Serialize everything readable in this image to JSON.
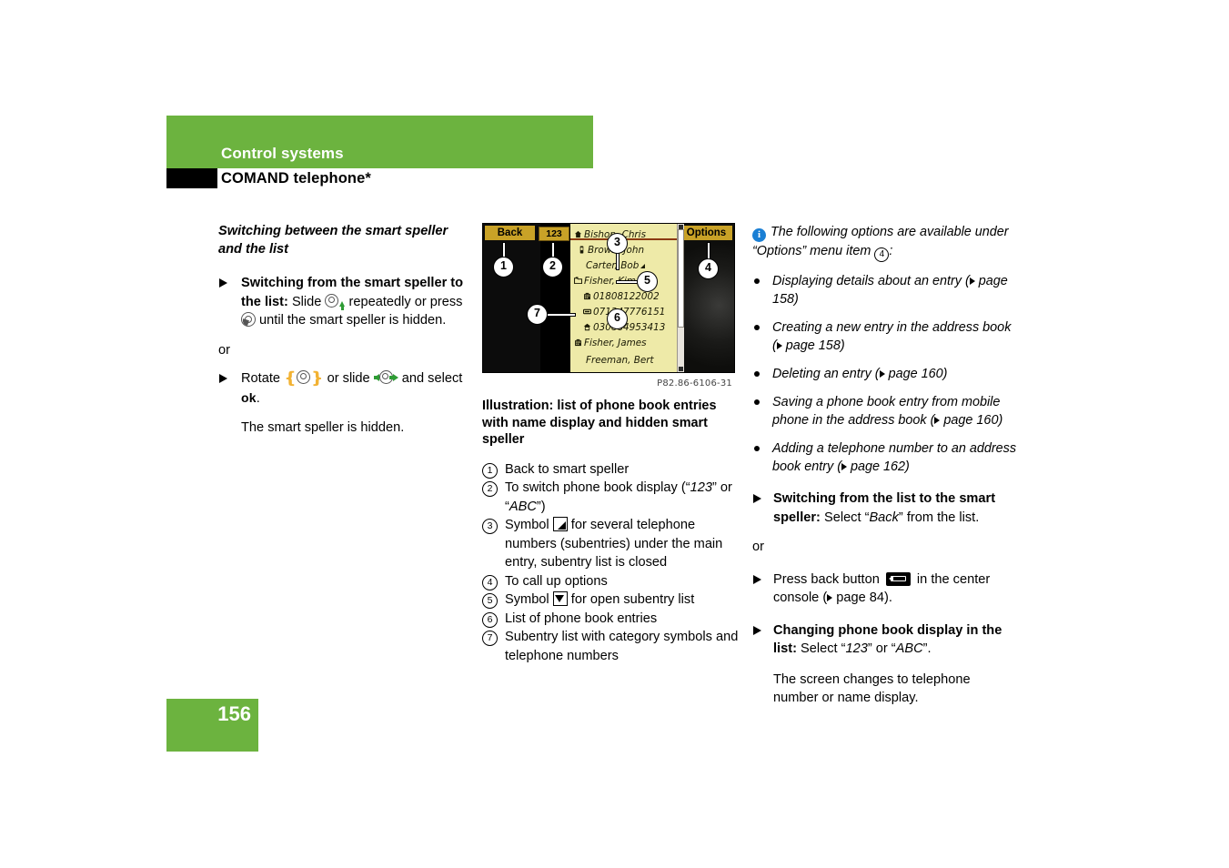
{
  "header": {
    "section": "Control systems",
    "subsection": "COMAND telephone*"
  },
  "footer": {
    "page_number": "156"
  },
  "left_column": {
    "subhead": "Switching between the smart speller and the list",
    "item1": {
      "bold_lead": "Switching from the smart speller to the list:",
      "text_a": " Slide ",
      "text_b": " repeatedly or press ",
      "text_c": " until the smart speller is hidden."
    },
    "or_label": "or",
    "item2": {
      "text_a": "Rotate ",
      "text_b": " or slide ",
      "text_c": " and select ",
      "ok_label": "ok",
      "text_d": "."
    },
    "result": "The smart speller is hidden."
  },
  "illustration": {
    "code": "P82.86-6106-31",
    "screen": {
      "back_button": "Back",
      "num_button": "123",
      "options_button": "Options",
      "entries": [
        {
          "icon": "home-icon",
          "text": "Bishop, Chris",
          "caret": false
        },
        {
          "icon": "mobile-icon",
          "text": "Brown, John",
          "caret": false
        },
        {
          "icon": "none",
          "text": "Carter, Bob",
          "caret": true
        },
        {
          "icon": "openfolder-icon",
          "text": "Fisher, Kim",
          "caret": true
        },
        {
          "icon": "office-icon",
          "text": "01808122002",
          "caret": false
        },
        {
          "icon": "fax-icon",
          "text": "071247776151",
          "caret": false
        },
        {
          "icon": "home-icon",
          "text": "030884953413",
          "caret": false
        },
        {
          "icon": "office-icon",
          "text": "Fisher, James",
          "caret": false
        },
        {
          "icon": "none",
          "text": "Freeman, Bert",
          "caret": false
        }
      ]
    },
    "callouts": [
      "1",
      "2",
      "3",
      "4",
      "5",
      "6",
      "7"
    ],
    "caption": "Illustration: list of phone book entries with name display and hidden smart speller",
    "legend": [
      {
        "num": "1",
        "text": "Back to smart speller"
      },
      {
        "num": "2",
        "text_a": "To switch phone book display (“",
        "em1": "123",
        "text_b": "” or “",
        "em2": "ABC",
        "text_c": "”)"
      },
      {
        "num": "3",
        "text_a": "Symbol ",
        "symbol": "corner-triangle",
        "text_b": " for several telephone numbers (subentries) under the main entry, subentry list is closed"
      },
      {
        "num": "4",
        "text": "To call up options"
      },
      {
        "num": "5",
        "text_a": "Symbol ",
        "symbol": "down-triangle",
        "text_b": " for open subentry list"
      },
      {
        "num": "6",
        "text": "List of phone book entries"
      },
      {
        "num": "7",
        "text": "Subentry list with category symbols and telephone numbers"
      }
    ]
  },
  "right_column": {
    "info_note": {
      "text_a": "The following options are available under “Options” menu item ",
      "ref_num": "4",
      "text_b": ":"
    },
    "options": [
      {
        "text_a": "Displaying details about an entry (",
        "ref": " page 158",
        "text_b": ")"
      },
      {
        "text_a": "Creating a new entry in the address book (",
        "ref": " page 158",
        "text_b": ")"
      },
      {
        "text_a": "Deleting an entry (",
        "ref": " page 160",
        "text_b": ")"
      },
      {
        "text_a": "Saving a phone book entry from mobile phone in the address book (",
        "ref": " page 160",
        "text_b": ")"
      },
      {
        "text_a": "Adding a telephone number to an address book entry (",
        "ref": " page 162",
        "text_b": ")"
      }
    ],
    "item_switch": {
      "bold_lead": "Switching from the list to the smart speller:",
      "text_a": " Select “",
      "em": "Back",
      "text_b": "” from the list."
    },
    "or_label": "or",
    "item_press": {
      "text_a": "Press back button ",
      "text_b": " in the center console (",
      "ref": " page 84",
      "text_c": ")."
    },
    "item_change": {
      "bold_lead": "Changing phone book display in the list:",
      "text_a": " Select “",
      "em1": "123",
      "text_b": "” or “",
      "em2": "ABC",
      "text_c": "”."
    },
    "result": "The screen changes to telephone number or name display."
  }
}
